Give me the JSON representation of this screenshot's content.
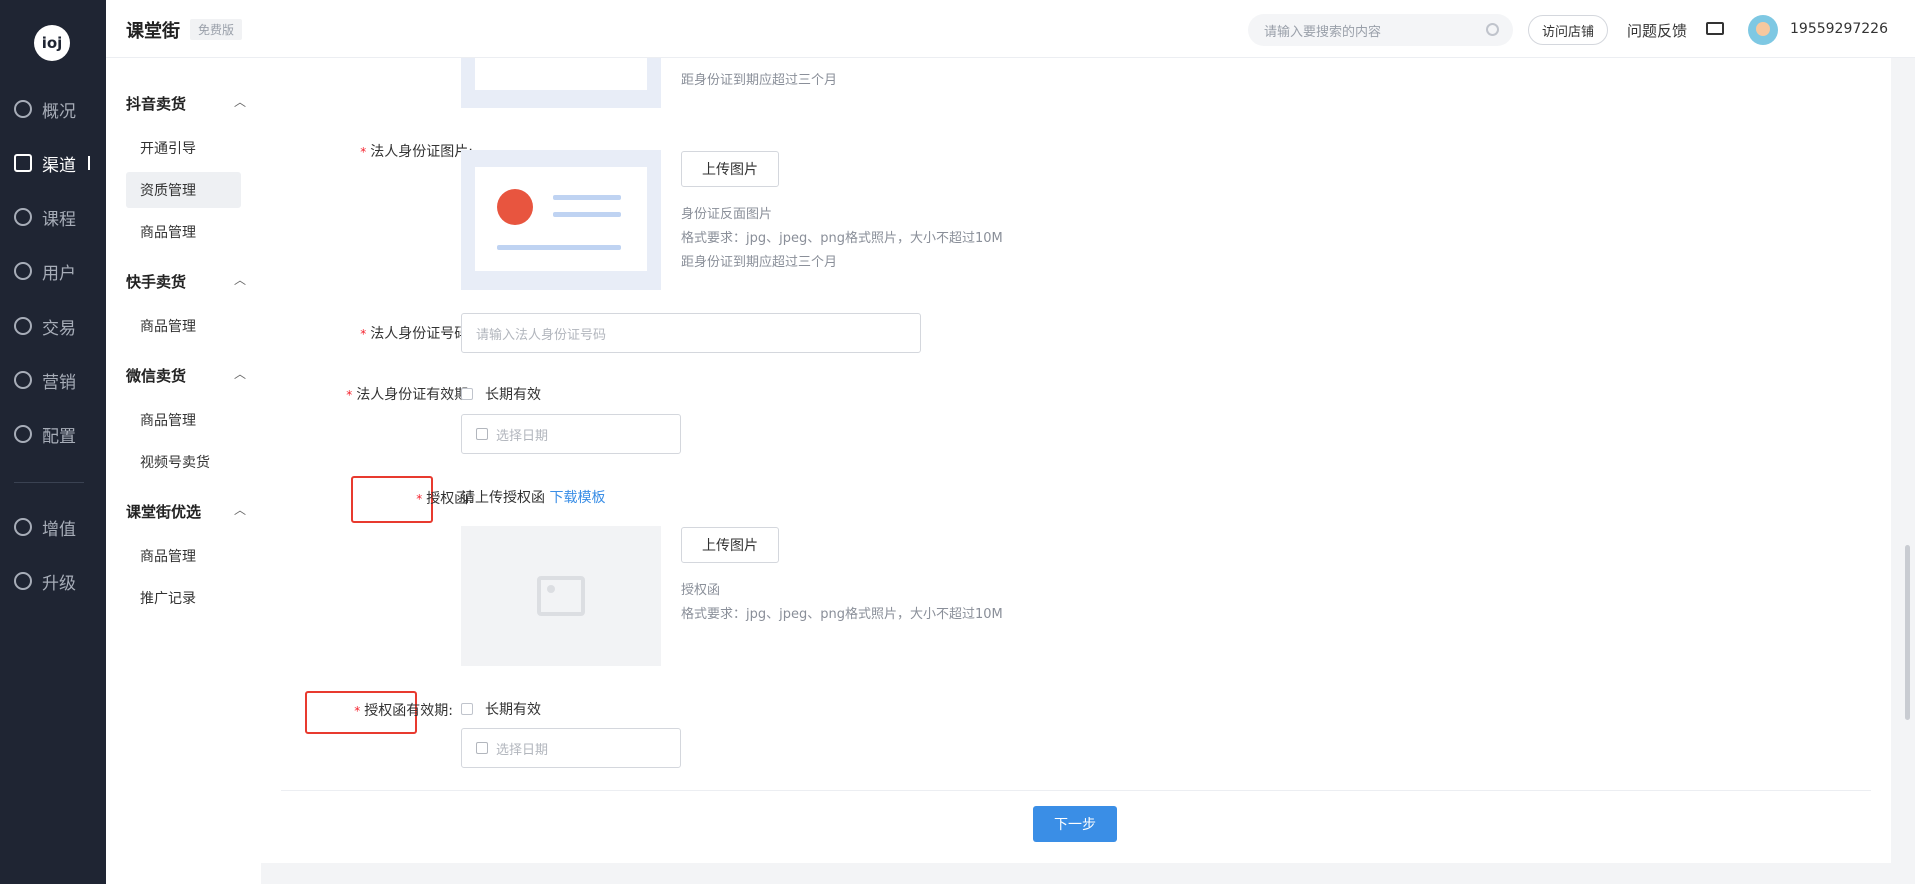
{
  "leftnav": {
    "logo": "ioj",
    "items": [
      {
        "label": "概况",
        "icon": "pie-chart-icon"
      },
      {
        "label": "渠道",
        "icon": "store-icon"
      },
      {
        "label": "课程",
        "icon": "book-icon"
      },
      {
        "label": "用户",
        "icon": "user-icon"
      },
      {
        "label": "交易",
        "icon": "exchange-icon"
      },
      {
        "label": "营销",
        "icon": "marketing-icon"
      },
      {
        "label": "配置",
        "icon": "gear-icon"
      },
      {
        "label": "增值",
        "icon": "value-added-icon"
      },
      {
        "label": "升级",
        "icon": "upgrade-icon"
      }
    ]
  },
  "topbar": {
    "brand": "课堂街",
    "edition": "免费版",
    "search_placeholder": "请输入要搜索的内容",
    "visit_store": "访问店铺",
    "feedback": "问题反馈",
    "phone": "19559297226"
  },
  "subnav": {
    "groups": [
      {
        "title": "抖音卖货",
        "items": [
          "开通引导",
          "资质管理",
          "商品管理"
        ]
      },
      {
        "title": "快手卖货",
        "items": [
          "商品管理"
        ]
      },
      {
        "title": "微信卖货",
        "items": [
          "商品管理",
          "视频号卖货"
        ]
      },
      {
        "title": "课堂街优选",
        "items": [
          "商品管理",
          "推广记录"
        ]
      }
    ]
  },
  "form": {
    "top_hint": "距身份证到期应超过三个月",
    "id_image_label": "法人身份证图片:",
    "upload_label": "上传图片",
    "id_back_hint": "身份证反面图片",
    "format_hint": "格式要求：jpg、jpeg、png格式照片，大小不超过10M",
    "expiry_hint": "距身份证到期应超过三个月",
    "id_number_label": "法人身份证号码:",
    "id_number_placeholder": "请输入法人身份证号码",
    "id_validity_label": "法人身份证有效期:",
    "long_term": "长期有效",
    "date_placeholder": "选择日期",
    "auth_label": "授权函:",
    "auth_prompt": "请上传授权函",
    "download_template": "下载模板",
    "auth_hint": "授权函",
    "auth_validity_label": "授权函有效期:",
    "next_button": "下一步"
  },
  "colors": {
    "accent": "#3a8ee6",
    "required": "#f5222d",
    "highlight_box": "#e83a2f",
    "nav_bg": "#1f2533"
  }
}
